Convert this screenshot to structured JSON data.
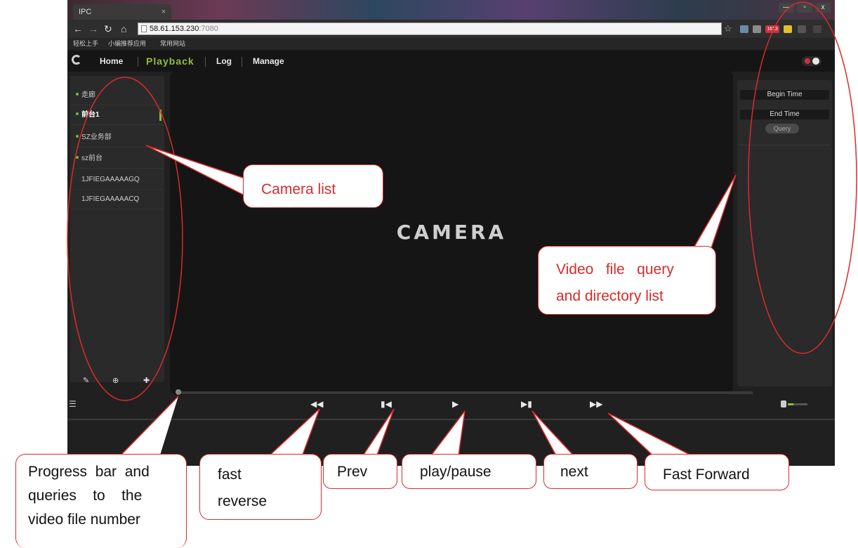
{
  "browser": {
    "tab_title": "IPC",
    "tab_close": "×",
    "url_host": "58.61.153.230",
    "url_port": ":7080",
    "bookmarks": [
      "轻松上手",
      "小编推荐应用",
      "常用网站"
    ],
    "window_controls": [
      "—",
      "▫",
      "x"
    ],
    "extension_badge": "1613",
    "colors": {
      "accent": "#8fbf3e",
      "callout": "#d92b2b"
    }
  },
  "app": {
    "nav": {
      "home": "Home",
      "playback": "Playback",
      "log": "Log",
      "manage": "Manage"
    },
    "cameras": [
      {
        "label": "走廊",
        "bullet": true
      },
      {
        "label": "前台1",
        "bullet": true,
        "selected": true
      },
      {
        "label": "SZ业务部",
        "bullet": true
      },
      {
        "label": "sz前台",
        "bullet": true
      },
      {
        "label": "1JFIEGAAAAAGQ",
        "bullet": false
      },
      {
        "label": "1JFIEGAAAAACQ",
        "bullet": false
      }
    ],
    "viewer_logo": "CAMERA",
    "query_panel": {
      "begin_time": "Begin Time",
      "end_time": "End Time",
      "query": "Query"
    },
    "controls": {
      "fast_reverse": "◀◀",
      "prev": "▮◀",
      "play": "▶",
      "next": "▶▮",
      "fast_forward": "▶▶",
      "list": "☰"
    },
    "left_tools": [
      "✎",
      "⊕",
      "✚"
    ]
  },
  "annotations": {
    "camera_list": "Camera list",
    "video_query_line1": "Video   file   query",
    "video_query_line2": "and directory list",
    "progress_line1": "Progress  bar  and",
    "progress_line2": "queries    to    the",
    "progress_line3": "video file number",
    "fast_reverse_line1": "fast",
    "fast_reverse_line2": "reverse",
    "prev": "Prev",
    "play_pause": "play/pause",
    "next": "next",
    "fast_forward": "Fast Forward"
  }
}
